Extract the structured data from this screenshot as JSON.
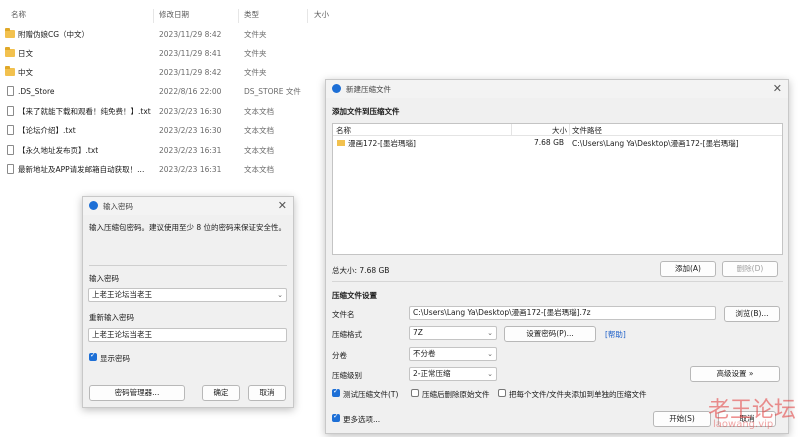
{
  "explorer": {
    "headers": {
      "name": "名称",
      "date": "修改日期",
      "type": "类型",
      "size": "大小"
    },
    "rows": [
      {
        "name": "附赠伪娘CG（中文）",
        "date": "2023/11/29 8:42",
        "type": "文件夹",
        "icon": "folder-icon"
      },
      {
        "name": "日文",
        "date": "2023/11/29 8:41",
        "type": "文件夹",
        "icon": "folder-icon"
      },
      {
        "name": "中文",
        "date": "2023/11/29 8:42",
        "type": "文件夹",
        "icon": "folder-icon"
      },
      {
        "name": ".DS_Store",
        "date": "2022/8/16 22:00",
        "type": "DS_STORE 文件",
        "icon": "file-icon"
      },
      {
        "name": "【来了就能下载和观看！纯免费！】.txt",
        "date": "2023/2/23 16:30",
        "type": "文本文档",
        "icon": "file-icon"
      },
      {
        "name": "【论坛介绍】.txt",
        "date": "2023/2/23 16:30",
        "type": "文本文档",
        "icon": "file-icon"
      },
      {
        "name": "【永久地址发布页】.txt",
        "date": "2023/2/23 16:31",
        "type": "文本文档",
        "icon": "file-icon"
      },
      {
        "name": "最新地址及APP请发邮箱自动获取！...",
        "date": "2023/2/23 16:31",
        "type": "文本文档",
        "icon": "file-icon"
      }
    ]
  },
  "password_dialog": {
    "title": "输入密码",
    "description": "输入压缩包密码。建议使用至少 8 位的密码来保证安全性。",
    "enter_label": "输入密码",
    "enter_value": "上老王论坛当老王",
    "reenter_label": "重新输入密码",
    "reenter_value": "上老王论坛当老王",
    "show_password": "显示密码",
    "manager_button": "密码管理器...",
    "ok_button": "确定",
    "cancel_button": "取消"
  },
  "archive_dialog": {
    "title": "新建压缩文件",
    "add_section": "添加文件到压缩文件",
    "columns": {
      "name": "名称",
      "size": "大小",
      "path": "文件路径"
    },
    "files": [
      {
        "name": "漫画172-[墨岩瑪瑙]",
        "size": "7.68 GB",
        "path": "C:\\Users\\Lang Ya\\Desktop\\漫画172-[墨岩瑪瑙]"
      }
    ],
    "total_size": "总大小: 7.68 GB",
    "add_button": "添加(A)",
    "delete_button": "删除(D)",
    "settings_section": "压缩文件设置",
    "filename_label": "文件名",
    "filename_value": "C:\\Users\\Lang Ya\\Desktop\\漫画172-[墨岩瑪瑙].7z",
    "browse_button": "浏览(B)...",
    "format_label": "压缩格式",
    "format_value": "7Z",
    "set_password_button": "设置密码(P)...",
    "help_link": "[帮助]",
    "split_label": "分卷",
    "split_value": "不分卷",
    "level_label": "压缩级别",
    "level_value": "2-正常压缩",
    "advanced_button": "高级设置 »",
    "test_check": "测试压缩文件(T)",
    "delete_check": "压缩后删除原始文件",
    "each_check": "把每个文件/文件夹添加到单独的压缩文件",
    "more_options": "更多选项...",
    "start_button": "开始(S)",
    "cancel_button": "取消"
  },
  "watermark": {
    "text": "老王论坛",
    "subtext": "laowang.vip",
    "color": "#e23a3a"
  }
}
